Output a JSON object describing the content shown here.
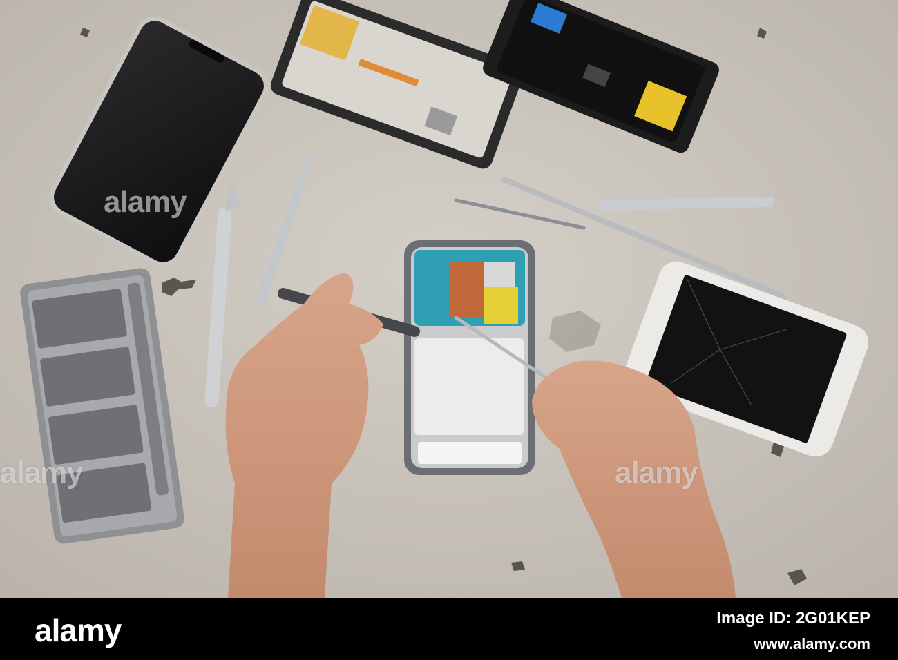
{
  "watermark": {
    "text": "alamy"
  },
  "footer": {
    "logo": "alamy",
    "image_id": "Image ID: 2G01KEP",
    "url": "www.alamy.com"
  }
}
